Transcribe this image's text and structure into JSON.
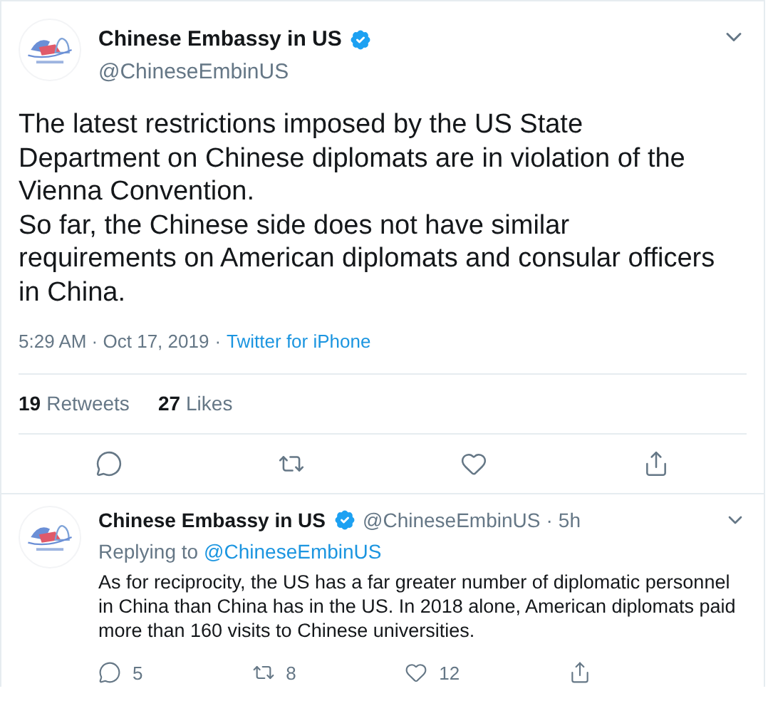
{
  "tweet": {
    "name": "Chinese Embassy in US",
    "verified": true,
    "handle": "@ChineseEmbinUS",
    "text": "The latest restrictions imposed by the US State Department on Chinese diplomats are in violation of the Vienna Convention.\nSo far, the Chinese side does not have similar requirements on American diplomats and consular officers in China.",
    "time": "5:29 AM · Oct 17, 2019",
    "separator": "·",
    "source": "Twitter for iPhone",
    "stats": [
      {
        "count": "19",
        "label": "Retweets"
      },
      {
        "count": "27",
        "label": "Likes"
      }
    ],
    "actions": [
      {
        "kind": "reply"
      },
      {
        "kind": "retweet"
      },
      {
        "kind": "like"
      },
      {
        "kind": "share"
      }
    ]
  },
  "reply": {
    "name": "Chinese Embassy in US",
    "verified": true,
    "handle": "@ChineseEmbinUS",
    "separator": "·",
    "age": "5h",
    "replying_label": "Replying to",
    "replying_to": "@ChineseEmbinUS",
    "text": "As for reciprocity, the US has a far greater number of diplomatic personnel in China than China has in the US. In 2018 alone, American diplomats paid more than 160 visits to Chinese universities.",
    "actions": [
      {
        "kind": "reply",
        "count": "5"
      },
      {
        "kind": "retweet",
        "count": "8"
      },
      {
        "kind": "like",
        "count": "12"
      },
      {
        "kind": "share"
      }
    ]
  }
}
